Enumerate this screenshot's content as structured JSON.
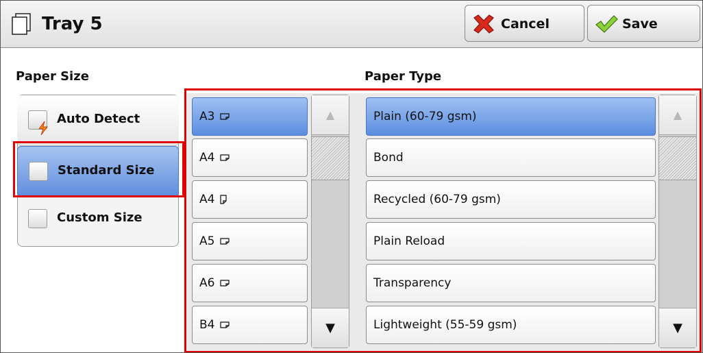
{
  "header": {
    "title": "Tray 5",
    "cancel_label": "Cancel",
    "save_label": "Save"
  },
  "paper_size": {
    "label": "Paper Size",
    "options": [
      {
        "label": "Auto Detect",
        "selected": false
      },
      {
        "label": "Standard Size",
        "selected": true
      },
      {
        "label": "Custom Size",
        "selected": false
      }
    ],
    "sizes": [
      {
        "label": "A3",
        "orientation": "landscape",
        "selected": true
      },
      {
        "label": "A4",
        "orientation": "landscape",
        "selected": false
      },
      {
        "label": "A4",
        "orientation": "portrait",
        "selected": false
      },
      {
        "label": "A5",
        "orientation": "landscape",
        "selected": false
      },
      {
        "label": "A6",
        "orientation": "landscape",
        "selected": false
      },
      {
        "label": "B4",
        "orientation": "landscape",
        "selected": false
      }
    ],
    "scroll_up_glyph": "▲",
    "scroll_down_glyph": "▼"
  },
  "paper_type": {
    "label": "Paper Type",
    "items": [
      {
        "label": "Plain (60-79 gsm)",
        "selected": true
      },
      {
        "label": "Bond",
        "selected": false
      },
      {
        "label": "Recycled (60-79 gsm)",
        "selected": false
      },
      {
        "label": "Plain Reload",
        "selected": false
      },
      {
        "label": "Transparency",
        "selected": false
      },
      {
        "label": "Lightweight (55-59 gsm)",
        "selected": false
      }
    ],
    "scroll_up_glyph": "▲",
    "scroll_down_glyph": "▼"
  },
  "colors": {
    "selected": "#6f9ae4",
    "highlight": "#e00000"
  },
  "icons": {
    "tray": "tray-icon",
    "cancel": "cancel-x-icon",
    "save": "save-check-icon",
    "auto_detect": "auto-detect-lightning-icon",
    "orientation": "paper-orientation-icon"
  }
}
